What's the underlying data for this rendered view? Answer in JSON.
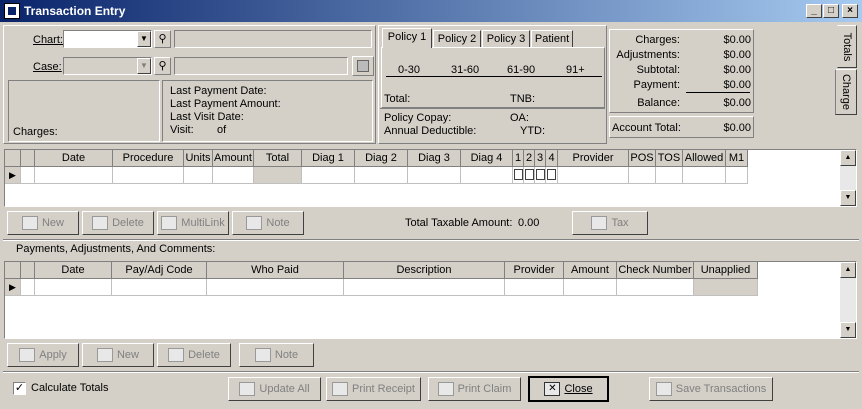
{
  "window": {
    "title": "Transaction Entry",
    "min": "_",
    "max": "□",
    "close": "×"
  },
  "header": {
    "chart_label": "Chart:",
    "case_label": "Case:",
    "last_payment_date": "Last Payment Date:",
    "last_payment_amount": "Last Payment Amount:",
    "last_visit_date": "Last Visit Date:",
    "visit": "Visit:",
    "visit_of": "of",
    "charges": "Charges:"
  },
  "policy": {
    "tabs": [
      "Policy 1",
      "Policy 2",
      "Policy 3",
      "Patient"
    ],
    "aging": [
      "0-30",
      "31-60",
      "61-90",
      "91+"
    ],
    "total": "Total:",
    "tnb": "TNB:",
    "copay": "Policy Copay:",
    "oa": "OA:",
    "deductible": "Annual Deductible:",
    "ytd": "YTD:"
  },
  "totals": {
    "charges_label": "Charges:",
    "charges": "$0.00",
    "adjustments_label": "Adjustments:",
    "adjustments": "$0.00",
    "subtotal_label": "Subtotal:",
    "subtotal": "$0.00",
    "payment_label": "Payment:",
    "payment": "$0.00",
    "balance_label": "Balance:",
    "balance": "$0.00",
    "account_total_label": "Account Total:",
    "account_total": "$0.00"
  },
  "side_tabs": [
    "Totals",
    "Charge"
  ],
  "charges_grid": {
    "columns": [
      "Date",
      "Procedure",
      "Units",
      "Amount",
      "Total",
      "Diag 1",
      "Diag 2",
      "Diag 3",
      "Diag 4",
      "1",
      "2",
      "3",
      "4",
      "Provider",
      "POS",
      "TOS",
      "Allowed",
      "M1"
    ]
  },
  "charge_buttons": {
    "new": "New",
    "delete": "Delete",
    "multilink": "MultiLink",
    "note": "Note",
    "tax": "Tax"
  },
  "taxable": {
    "label": "Total Taxable Amount:",
    "value": "0.00"
  },
  "payments": {
    "section_title": "Payments, Adjustments, And Comments:",
    "columns": [
      "Date",
      "Pay/Adj Code",
      "Who Paid",
      "Description",
      "Provider",
      "Amount",
      "Check Number",
      "Unapplied"
    ]
  },
  "payment_buttons": {
    "apply": "Apply",
    "new": "New",
    "delete": "Delete",
    "note": "Note"
  },
  "footer": {
    "calculate_totals": "Calculate Totals",
    "checked": "✓",
    "update_all": "Update All",
    "print_receipt": "Print Receipt",
    "print_claim": "Print Claim",
    "close": "Close",
    "save": "Save Transactions"
  }
}
